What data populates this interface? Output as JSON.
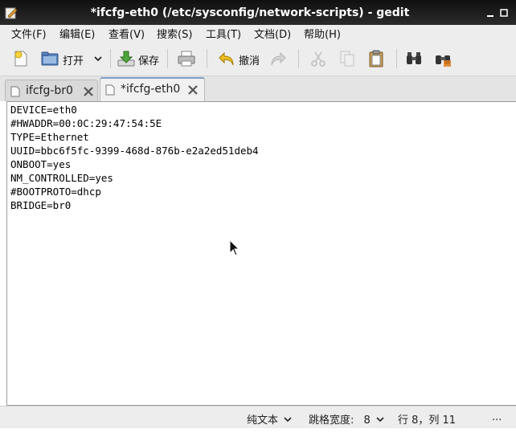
{
  "window": {
    "title": "*ifcfg-eth0 (/etc/sysconfig/network-scripts) - gedit",
    "icon": "gedit-icon"
  },
  "menu": [
    "文件(F)",
    "编辑(E)",
    "查看(V)",
    "搜索(S)",
    "工具(T)",
    "文档(D)",
    "帮助(H)"
  ],
  "toolbar": {
    "open_label": "打开",
    "save_label": "保存",
    "undo_label": "撤消"
  },
  "tabs": [
    {
      "label": "ifcfg-br0",
      "active": false
    },
    {
      "label": "*ifcfg-eth0",
      "active": true
    }
  ],
  "document": {
    "lines": [
      "DEVICE=eth0",
      "#HWADDR=00:0C:29:47:54:5E",
      "TYPE=Ethernet",
      "UUID=bbc6f5fc-9399-468d-876b-e2a2ed51deb4",
      "ONBOOT=yes",
      "NM_CONTROLLED=yes",
      "#BOOTPROTO=dhcp",
      "BRIDGE=br0"
    ]
  },
  "status": {
    "syntax": "纯文本",
    "tab_width_label": "跳格宽度:",
    "tab_width_value": "8",
    "position": "行 8，列 11",
    "overflow": "..."
  },
  "colors": {
    "titlebar": "#1e1e1e",
    "chrome": "#ededed",
    "active_tab_accent": "#7d9ec8"
  }
}
